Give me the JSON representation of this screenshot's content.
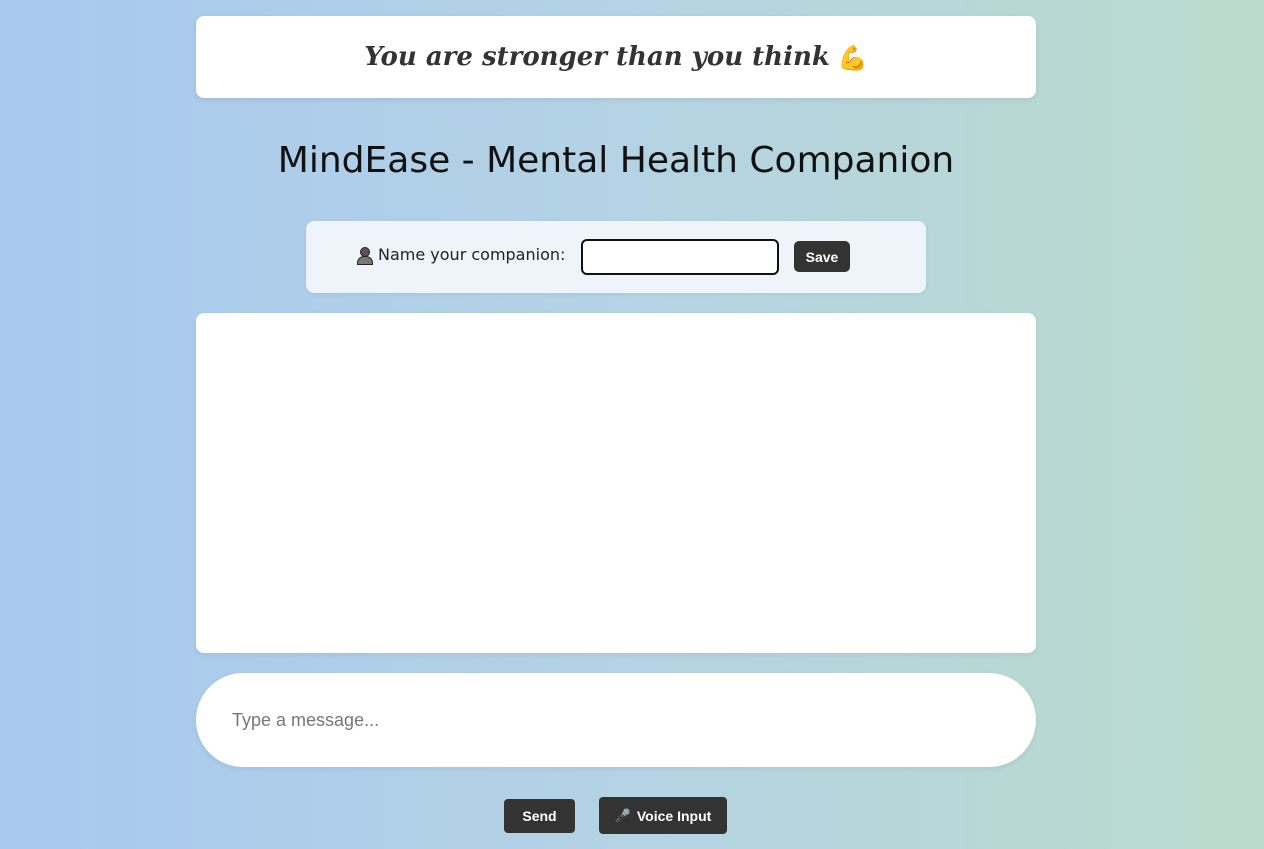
{
  "quote": {
    "text": "You are stronger than you think",
    "emoji": "💪"
  },
  "page_title": "MindEase - Mental Health Companion",
  "companion": {
    "label": "Name your companion:",
    "input_value": "",
    "save_label": "Save",
    "icon": "person-icon"
  },
  "chat": {
    "messages": []
  },
  "composer": {
    "placeholder": "Type a message...",
    "send_label": "Send",
    "voice_label": "Voice Input",
    "voice_icon": "🎤"
  },
  "colors": {
    "button_bg": "#333333",
    "gradient_left": "#a8c8ef",
    "gradient_right": "#badbcc"
  }
}
